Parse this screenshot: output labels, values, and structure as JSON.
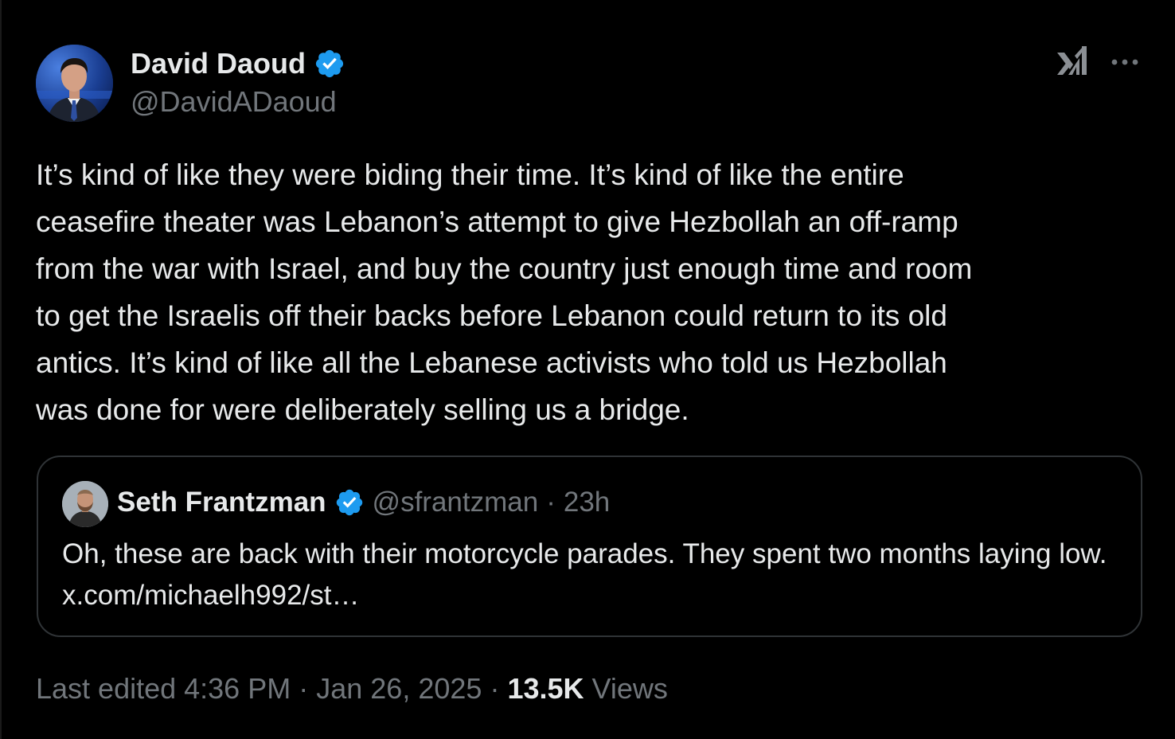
{
  "author": {
    "name": "David Daoud",
    "handle": "@DavidADaoud",
    "verified_color": "#1d9bf0"
  },
  "toolbar": {
    "logo_icon": "x-logo-icon",
    "more_icon": "more-options-icon"
  },
  "tweet": {
    "text": "It’s kind of like they were biding their time. It’s kind of like the entire\nceasefire theater was Lebanon’s attempt to give Hezbollah an off-ramp\nfrom the war with Israel, and buy the country just enough time and room\nto get the Israelis off their backs before Lebanon could return to its old\nantics. It’s kind of like all the Lebanese activists who told us Hezbollah\nwas done for were deliberately selling us a bridge."
  },
  "quote": {
    "name": "Seth Frantzman",
    "handle": "@sfrantzman",
    "separator": "·",
    "time": "23h",
    "text": "Oh, these are back with their motorcycle parades. They spent two months laying low. x.com/michaelh992/st…"
  },
  "footer": {
    "edited_label": "Last edited 4:36 PM",
    "sep1": "·",
    "date": "Jan 26, 2025",
    "sep2": "·",
    "views_count": "13.5K",
    "views_label": "Views"
  },
  "colors": {
    "background": "#000000",
    "text_primary": "#e7e9ea",
    "text_secondary": "#71767b",
    "border": "#2f3336",
    "verified": "#1d9bf0"
  }
}
